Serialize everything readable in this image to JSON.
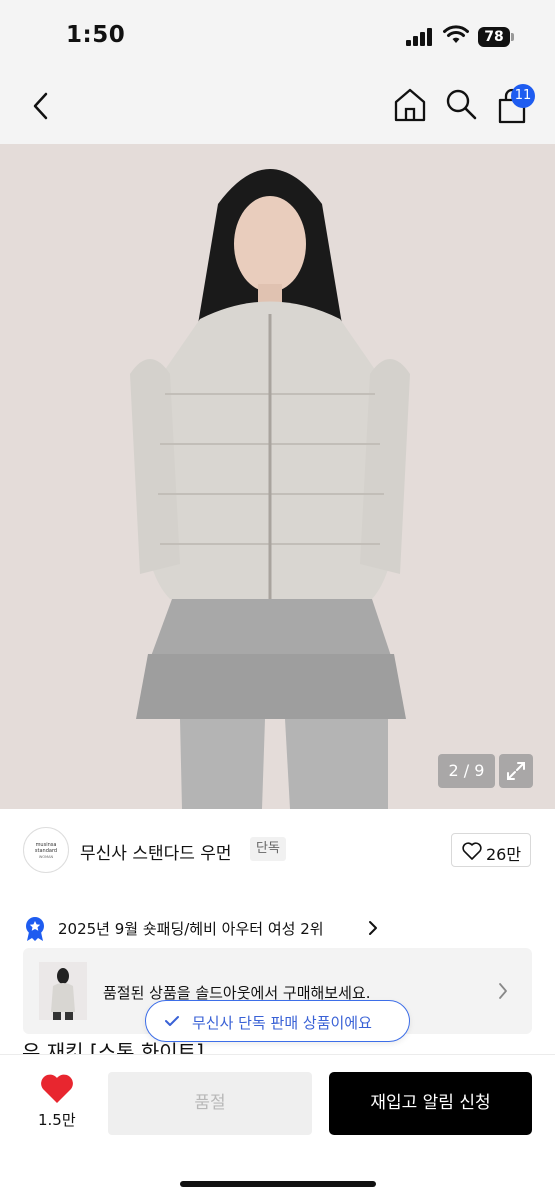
{
  "status_bar": {
    "time": "1:50",
    "battery": "78"
  },
  "nav": {
    "cart_count": "11"
  },
  "gallery": {
    "counter": "2 / 9"
  },
  "brand": {
    "logo_line1": "musinsa",
    "logo_line2": "standard",
    "logo_line3": "WOMAN",
    "name": "무신사 스탠다드 우먼",
    "exclusive_tag": "단독",
    "like_count": "26만"
  },
  "ranking": {
    "text": "2025년 9월 숏패딩/헤비 아우터 여성 2위"
  },
  "soldout_banner": {
    "text": "품절된 상품을 솔드아웃에서 구매해보세요."
  },
  "product": {
    "title_partial": "우 재킷 [스톤 화이트]"
  },
  "toast": {
    "text": "무신사 단독 판매 상품이에요"
  },
  "bottom": {
    "wish_count": "1.5만",
    "soldout_label": "품절",
    "restock_label": "재입고 알림 신청"
  },
  "colors": {
    "accent": "#1e5cf0",
    "toast_blue": "#3a62d6",
    "heart": "#e8262f"
  },
  "icons": [
    "back-icon",
    "home-icon",
    "search-icon",
    "cart-icon",
    "expand-icon",
    "heart-icon",
    "medal-icon",
    "chevron-right-icon",
    "check-icon"
  ]
}
